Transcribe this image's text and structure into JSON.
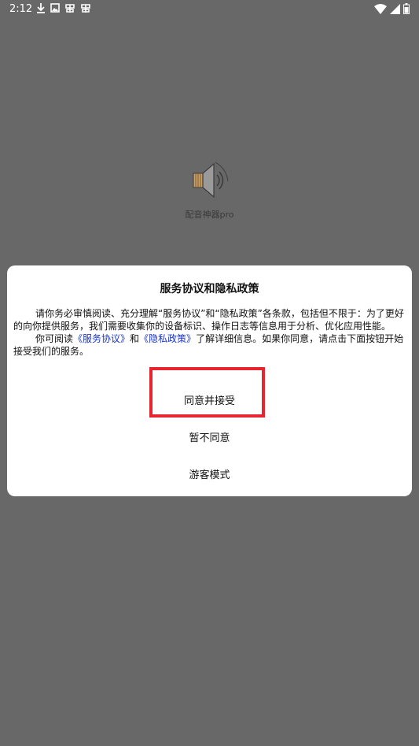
{
  "status_bar": {
    "time": "2:12",
    "left_icons": [
      "download-icon",
      "image-icon",
      "bug-icon",
      "bug-icon"
    ],
    "right_icons": [
      "wifi-icon",
      "signal-icon",
      "battery-icon"
    ]
  },
  "app": {
    "name": "配音神器pro",
    "logo_icon": "speaker-icon"
  },
  "dialog": {
    "title": "服务协议和隐私政策",
    "para1": "请你务必审慎阅读、充分理解“服务协议”和“隐私政策”各条款，包括但不限于：为了更好的向你提供服务，我们需要收集你的设备标识、操作日志等信息用于分析、优化应用性能。",
    "para2_prefix": "你可阅读",
    "link_service": "《服务协议》",
    "para2_and": "和",
    "link_privacy": "《隐私政策》",
    "para2_suffix": "了解详细信息。如果你同意，请点击下面按钮开始接受我们的服务。",
    "agree_button": "同意并接受",
    "decline_button": "暂不同意",
    "guest_button": "游客模式"
  },
  "colors": {
    "overlay": "#686868",
    "link": "#1a36c9",
    "highlight": "#e6252e"
  }
}
